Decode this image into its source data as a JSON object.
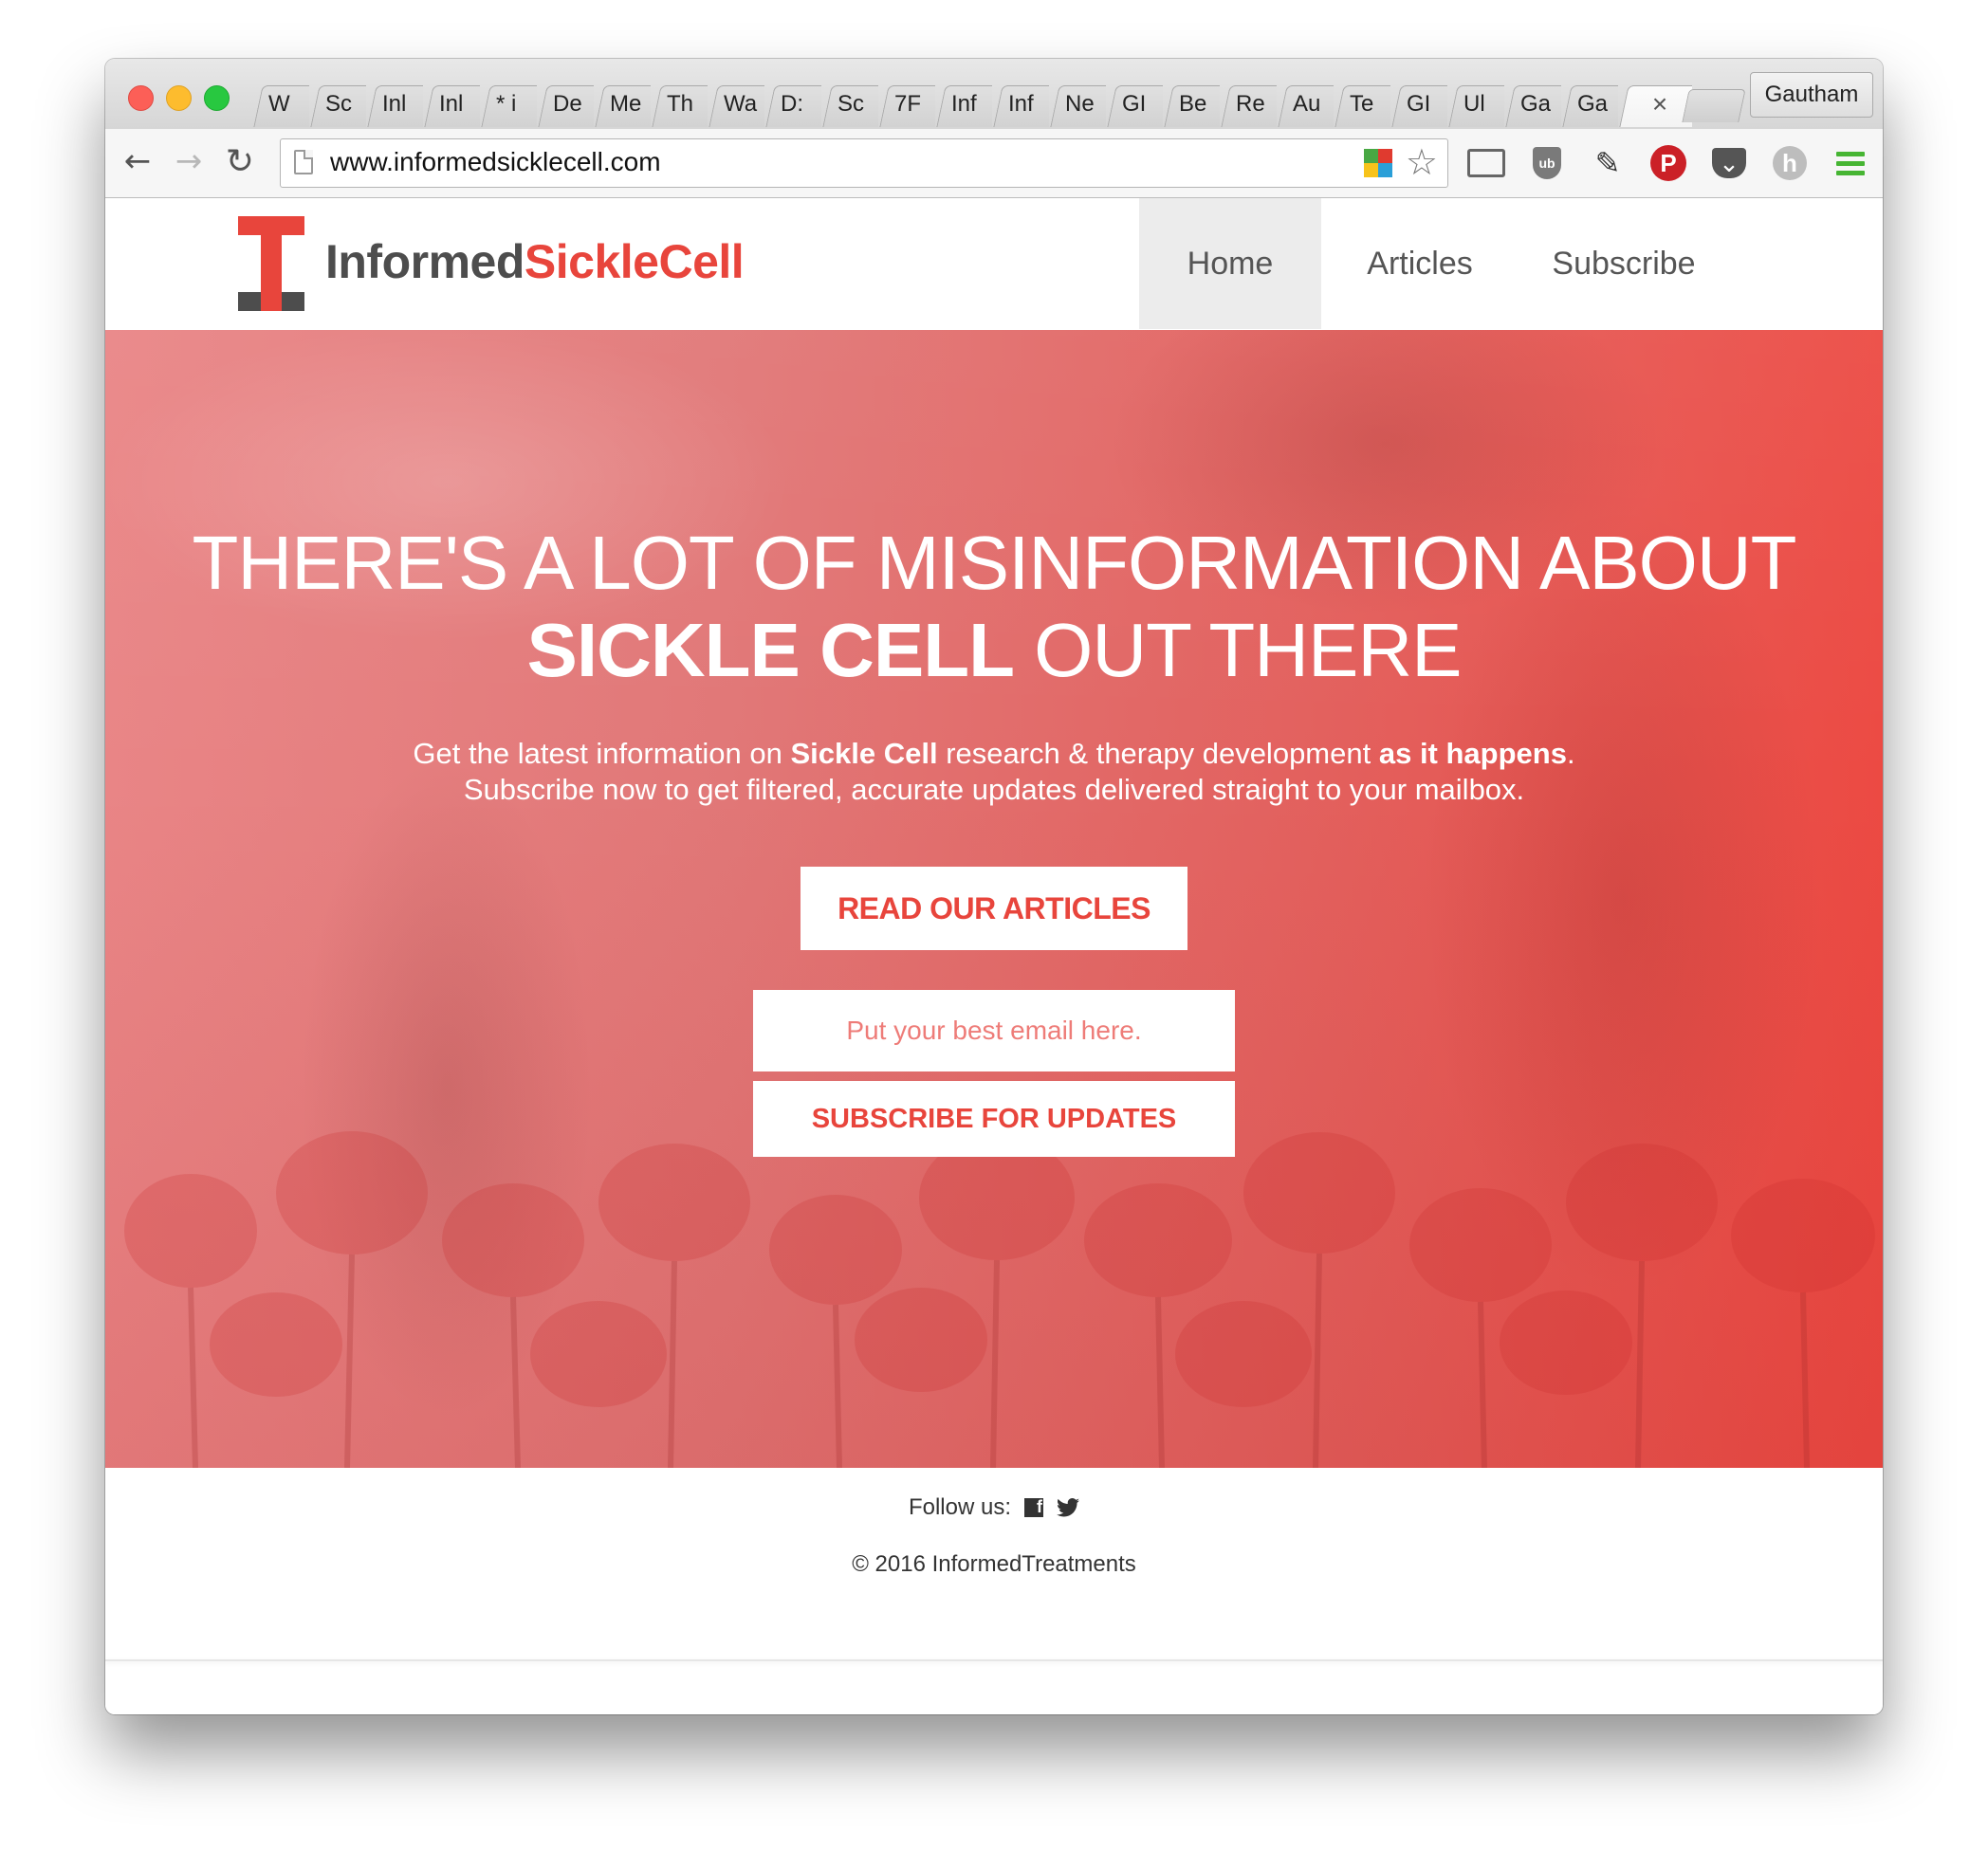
{
  "browser": {
    "tabs": [
      "W",
      "Sc",
      "Inl",
      "Inl",
      "* i",
      "De",
      "Me",
      "Th",
      "Wa",
      "D:",
      "Sc",
      "7F",
      "Inf",
      "Inf",
      "Ne",
      "GI",
      "Be",
      "Re",
      "Au",
      "Te",
      "GI",
      "Ul",
      "Ga",
      "Ga"
    ],
    "active_tab_close": "×",
    "profile_name": "Gautham",
    "url": "www.informedsicklecell.com",
    "extension_icons": [
      "avg-icon",
      "cast-icon",
      "ublock-icon",
      "eyedropper-icon",
      "pinterest-icon",
      "pocket-icon",
      "hypothesis-icon",
      "menu-icon"
    ]
  },
  "site": {
    "logo": {
      "part1": "Informed",
      "part2": "SickleCell",
      "mark_letter": "I"
    },
    "nav": {
      "home": "Home",
      "articles": "Articles",
      "subscribe": "Subscribe",
      "active": "Home"
    },
    "hero": {
      "title_line1": "THERE'S A LOT OF MISINFORMATION ABOUT",
      "title_bold": "SICKLE CELL",
      "title_rest": " OUT THERE",
      "sub_part1": "Get the latest information on ",
      "sub_bold1": "Sickle Cell",
      "sub_part2": " research & therapy development ",
      "sub_bold2": "as it happens",
      "sub_part3": ".",
      "sub_line2": "Subscribe now to get filtered, accurate updates delivered straight to your mailbox.",
      "read_button": "READ OUR ARTICLES",
      "email_placeholder": "Put your best email here.",
      "subscribe_button": "SUBSCRIBE FOR UPDATES"
    },
    "footer": {
      "follow_label": "Follow us:",
      "social": [
        "facebook-icon",
        "twitter-icon"
      ],
      "copyright": "© 2016 InformedTreatments"
    }
  },
  "colors": {
    "brand_red": "#e8453c",
    "logo_gray": "#4d4d4d",
    "nav_active_bg": "#ececec"
  }
}
